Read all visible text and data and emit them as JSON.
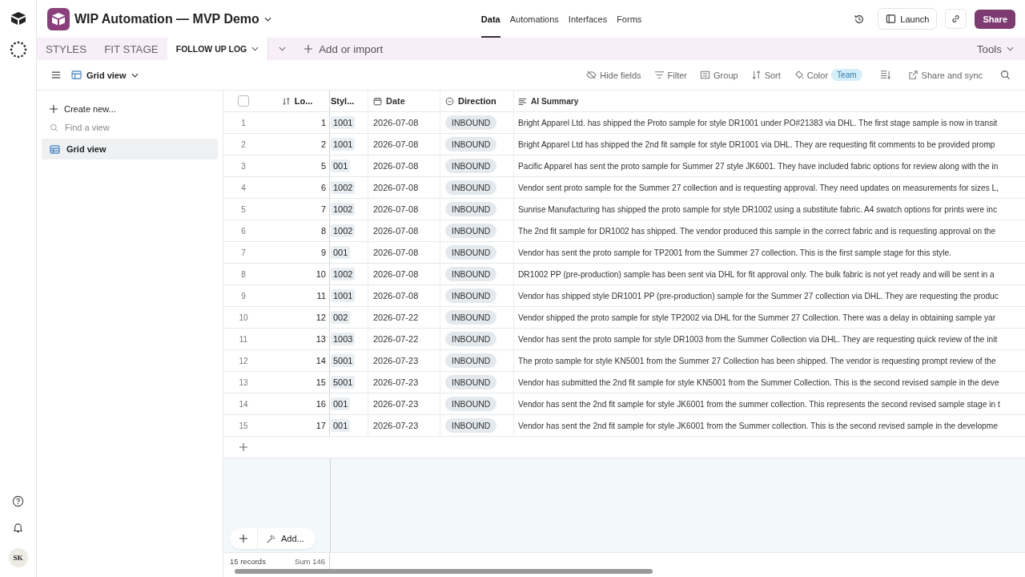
{
  "base": {
    "title": "WIP Automation — MVP Demo"
  },
  "nav": [
    {
      "label": "Data",
      "selected": true
    },
    {
      "label": "Automations",
      "selected": false
    },
    {
      "label": "Interfaces",
      "selected": false
    },
    {
      "label": "Forms",
      "selected": false
    }
  ],
  "header_actions": {
    "launch": "Launch",
    "share": "Share"
  },
  "tables": [
    {
      "label": "STYLES",
      "selected": false
    },
    {
      "label": "FIT STAGE",
      "selected": false
    },
    {
      "label": "FOLLOW UP LOG",
      "selected": true
    }
  ],
  "add_or_import": "Add or import",
  "tools": "Tools",
  "view": {
    "name": "Grid view"
  },
  "toolbar": [
    {
      "kind": "hide",
      "label": "Hide fields"
    },
    {
      "kind": "filter",
      "label": "Filter"
    },
    {
      "kind": "group",
      "label": "Group"
    },
    {
      "kind": "sort",
      "label": "Sort"
    },
    {
      "kind": "color",
      "label": "Color",
      "badge": "Team"
    },
    {
      "kind": "rowheight"
    },
    {
      "kind": "share",
      "label": "Share and sync"
    },
    {
      "kind": "search"
    }
  ],
  "sidebar": {
    "create": "Create new...",
    "find_placeholder": "Find a view",
    "items": [
      {
        "label": "Grid view",
        "selected": true
      }
    ]
  },
  "table": {
    "select_all": {
      "checked": false
    },
    "columns": [
      {
        "kind": "number",
        "label": "Lo..."
      },
      {
        "kind": "style",
        "label": "Styl..."
      },
      {
        "kind": "date",
        "label": "Date"
      },
      {
        "kind": "select",
        "label": "Direction"
      },
      {
        "kind": "text",
        "label": "AI Summary"
      }
    ],
    "rows": [
      {
        "index": "1",
        "lo": "1",
        "style": "1001",
        "date": "2026-07-08",
        "direction": "INBOUND",
        "summary": "Bright Apparel Ltd. has shipped the Proto sample for style DR1001 under PO#21383 via DHL. The first stage sample is now in transit"
      },
      {
        "index": "2",
        "lo": "2",
        "style": "1001",
        "date": "2026-07-08",
        "direction": "INBOUND",
        "summary": "Bright Apparel Ltd has shipped the 2nd fit sample for style DR1001 via DHL. They are requesting fit comments to be provided promp"
      },
      {
        "index": "3",
        "lo": "5",
        "style": "001",
        "date": "2026-07-08",
        "direction": "INBOUND",
        "summary": "Pacific Apparel has sent the proto sample for Summer 27 style JK6001. They have included fabric options for review along with the in"
      },
      {
        "index": "4",
        "lo": "6",
        "style": "1002",
        "date": "2026-07-08",
        "direction": "INBOUND",
        "summary": "Vendor sent proto sample for the Summer 27 collection and is requesting approval. They need updates on measurements for sizes L,"
      },
      {
        "index": "5",
        "lo": "7",
        "style": "1002",
        "date": "2026-07-08",
        "direction": "INBOUND",
        "summary": "Sunrise Manufacturing has shipped the proto sample for style DR1002 using a substitute fabric. A4 swatch options for prints were inc"
      },
      {
        "index": "6",
        "lo": "8",
        "style": "1002",
        "date": "2026-07-08",
        "direction": "INBOUND",
        "summary": "The 2nd fit sample for DR1002 has shipped. The vendor produced this sample in the correct fabric and is requesting approval on the"
      },
      {
        "index": "7",
        "lo": "9",
        "style": "001",
        "date": "2026-07-08",
        "direction": "INBOUND",
        "summary": "Vendor has sent the proto sample for TP2001 from the Summer 27 collection. This is the first sample stage for this style."
      },
      {
        "index": "8",
        "lo": "10",
        "style": "1002",
        "date": "2026-07-08",
        "direction": "INBOUND",
        "summary": "DR1002 PP (pre-production) sample has been sent via DHL for fit approval only. The bulk fabric is not yet ready and will be sent in a"
      },
      {
        "index": "9",
        "lo": "11",
        "style": "1001",
        "date": "2026-07-08",
        "direction": "INBOUND",
        "summary": "Vendor has shipped style DR1001 PP (pre-production) sample for the Summer 27 collection via DHL. They are requesting the produc"
      },
      {
        "index": "10",
        "lo": "12",
        "style": "002",
        "date": "2026-07-22",
        "direction": "INBOUND",
        "summary": "Vendor shipped the proto sample for style TP2002 via DHL for the Summer 27 Collection. There was a delay in obtaining sample yar"
      },
      {
        "index": "11",
        "lo": "13",
        "style": "1003",
        "date": "2026-07-22",
        "direction": "INBOUND",
        "summary": "Vendor has sent the proto sample for style DR1003 from the Summer Collection via DHL. They are requesting quick review of the init"
      },
      {
        "index": "12",
        "lo": "14",
        "style": "5001",
        "date": "2026-07-23",
        "direction": "INBOUND",
        "summary": "The proto sample for style KN5001 from the Summer 27 Collection has been shipped. The vendor is requesting prompt review of the"
      },
      {
        "index": "13",
        "lo": "15",
        "style": "5001",
        "date": "2026-07-23",
        "direction": "INBOUND",
        "summary": "Vendor has submitted the 2nd fit sample for style KN5001 from the Summer Collection. This is the second revised sample in the deve"
      },
      {
        "index": "14",
        "lo": "16",
        "style": "001",
        "date": "2026-07-23",
        "direction": "INBOUND",
        "summary": "Vendor has sent the 2nd fit sample for style JK6001 from the summer collection. This represents the second revised sample stage in t"
      },
      {
        "index": "15",
        "lo": "17",
        "style": "001",
        "date": "2026-07-23",
        "direction": "INBOUND",
        "summary": "Vendor has sent the 2nd fit sample for style JK6001 from the Summer collection. This is the second revised sample in the developme"
      }
    ]
  },
  "footer": {
    "add": "Add...",
    "records": "15 records",
    "sum_label": "Sum",
    "sum": "146"
  },
  "user": {
    "initials": "SK"
  }
}
